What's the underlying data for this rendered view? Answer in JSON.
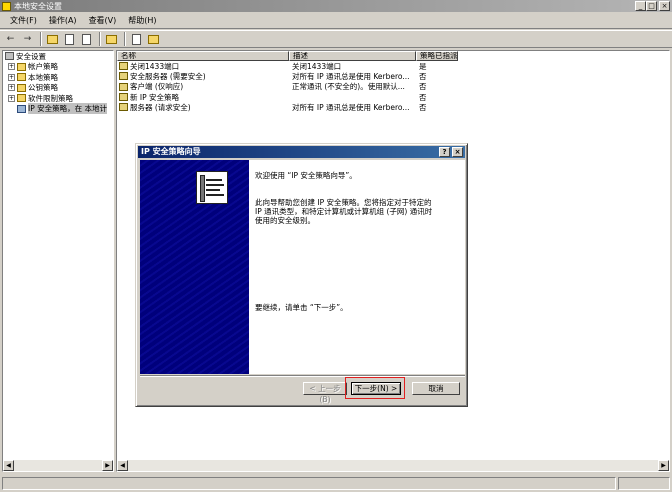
{
  "window": {
    "title": "本地安全设置"
  },
  "menu": [
    "文件(F)",
    "操作(A)",
    "查看(V)",
    "帮助(H)"
  ],
  "tree": {
    "root": "安全设置",
    "items": [
      {
        "label": "帐户策略",
        "expander": "+"
      },
      {
        "label": "本地策略",
        "expander": "+"
      },
      {
        "label": "公钥策略",
        "expander": "+"
      },
      {
        "label": "软件限制策略",
        "expander": "+"
      },
      {
        "label": "IP 安全策略，在 本地计",
        "expander": ""
      }
    ]
  },
  "list": {
    "columns": [
      "名称",
      "描述",
      "策略已指派"
    ],
    "rows": [
      {
        "name": "关闭1433端口",
        "desc": "关闭1433端口",
        "assigned": "是"
      },
      {
        "name": "安全服务器 (需要安全)",
        "desc": "对所有 IP 通讯总是使用 Kerbero...",
        "assigned": "否"
      },
      {
        "name": "客户端 (仅响应)",
        "desc": "正常通讯 (不安全的)。使用默认...",
        "assigned": "否"
      },
      {
        "name": "新 IP 安全策略",
        "desc": "",
        "assigned": "否"
      },
      {
        "name": "服务器 (请求安全)",
        "desc": "对所有 IP 通讯总是使用 Kerbero...",
        "assigned": "否"
      }
    ]
  },
  "dialog": {
    "title": "IP 安全策略向导",
    "help_label": "?",
    "close_label": "×",
    "welcome": "欢迎使用 “IP 安全策略向导”。",
    "desc_line1": "此向导帮助您创建 IP 安全策略。您将指定对于特定的",
    "desc_line2": "IP 通讯类型，和特定计算机或计算机组 (子网) 通讯时",
    "desc_line3": "使用的安全级别。",
    "continue": "要继续，请单击 “下一步”。",
    "back_label": "< 上一步(B)",
    "next_label": "下一步(N) >",
    "cancel_label": "取消"
  }
}
